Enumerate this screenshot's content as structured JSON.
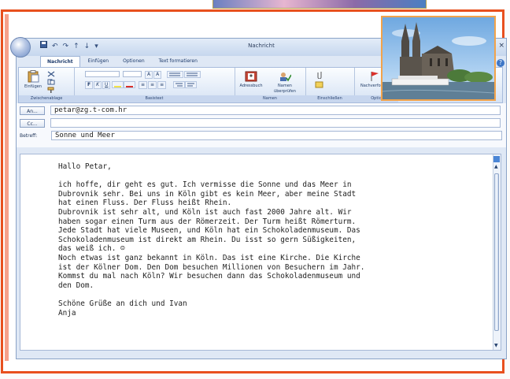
{
  "window": {
    "title": "Nachricht",
    "close_glyph": "×",
    "help_glyph": "?"
  },
  "quick_access": {
    "undo_glyph": "↶",
    "redo_glyph": "↷",
    "up_glyph": "↑",
    "down_glyph": "↓",
    "more_glyph": "▾"
  },
  "tabs": [
    {
      "label": "Nachricht",
      "active": true
    },
    {
      "label": "Einfügen"
    },
    {
      "label": "Optionen"
    },
    {
      "label": "Text formatieren"
    }
  ],
  "ribbon": {
    "groups": {
      "clipboard": "Zwischenablage",
      "basic_text": "Basistext",
      "names": "Namen",
      "include": "Einschließen",
      "options": "Optio"
    },
    "buttons": {
      "paste": "Einfügen",
      "address_book": "Adressbuch",
      "check_names": "Namen überprüfen",
      "followup": "Nachverfolgung"
    },
    "format_labels": {
      "bold": "F",
      "italic": "K",
      "underline": "U",
      "grow": "A",
      "shrink": "A",
      "align_left": "≡",
      "align_center": "≡",
      "align_right": "≡"
    }
  },
  "header": {
    "to_label": "An...",
    "to_value": "petar@zg.t-com.hr",
    "cc_label": "Cc...",
    "cc_value": "",
    "subject_label": "Betreff:",
    "subject_value": "Sonne und Meer"
  },
  "body": {
    "text": "Hallo Petar,\n\nich hoffe, dir geht es gut. Ich vermisse die Sonne und das Meer in\nDubrovnik sehr. Bei uns in Köln gibt es kein Meer, aber meine Stadt\nhat einen Fluss. Der Fluss heißt Rhein.\nDubrovnik ist sehr alt, und Köln ist auch fast 2000 Jahre alt. Wir\nhaben sogar einen Turm aus der Römerzeit. Der Turm heißt Römerturm.\nJede Stadt hat viele Museen, und Köln hat ein Schokoladenmuseum. Das\nSchokoladenmuseum ist direkt am Rhein. Du isst so gern Süßigkeiten,\ndas weiß ich. ☺\nNoch etwas ist ganz bekannt in Köln. Das ist eine Kirche. Die Kirche\nist der Kölner Dom. Den Dom besuchen Millionen von Besuchern im Jahr.\nKommst du mal nach Köln? Wir besuchen dann das Schokoladenmuseum und\nden Dom.\n\nSchöne Grüße an dich und Ivan\nAnja"
  },
  "colors": {
    "frame": "#e8501e",
    "photo_border": "#f2a34a"
  }
}
